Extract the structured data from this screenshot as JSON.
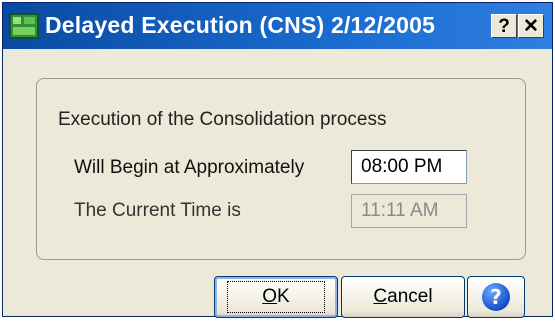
{
  "window": {
    "title": "Delayed Execution (CNS) 2/12/2005",
    "help_glyph": "?",
    "close_glyph": "✕"
  },
  "group": {
    "heading": "Execution of the Consolidation process"
  },
  "begin": {
    "label": "Will Begin at Approximately",
    "value": "08:00 PM"
  },
  "current": {
    "label": "The Current Time is",
    "value": "11:11 AM"
  },
  "buttons": {
    "ok_mnemonic": "O",
    "ok_rest": "K",
    "cancel_mnemonic": "C",
    "cancel_rest": "ancel",
    "help_glyph": "?"
  },
  "colors": {
    "titlebar": "#0a4aa2",
    "dialog_bg": "#ece9d8",
    "help_blue": "#1450c8"
  },
  "icons": {
    "app": "app-icon",
    "help_title": "question-icon",
    "close_title": "close-icon",
    "help_button": "help-icon"
  }
}
